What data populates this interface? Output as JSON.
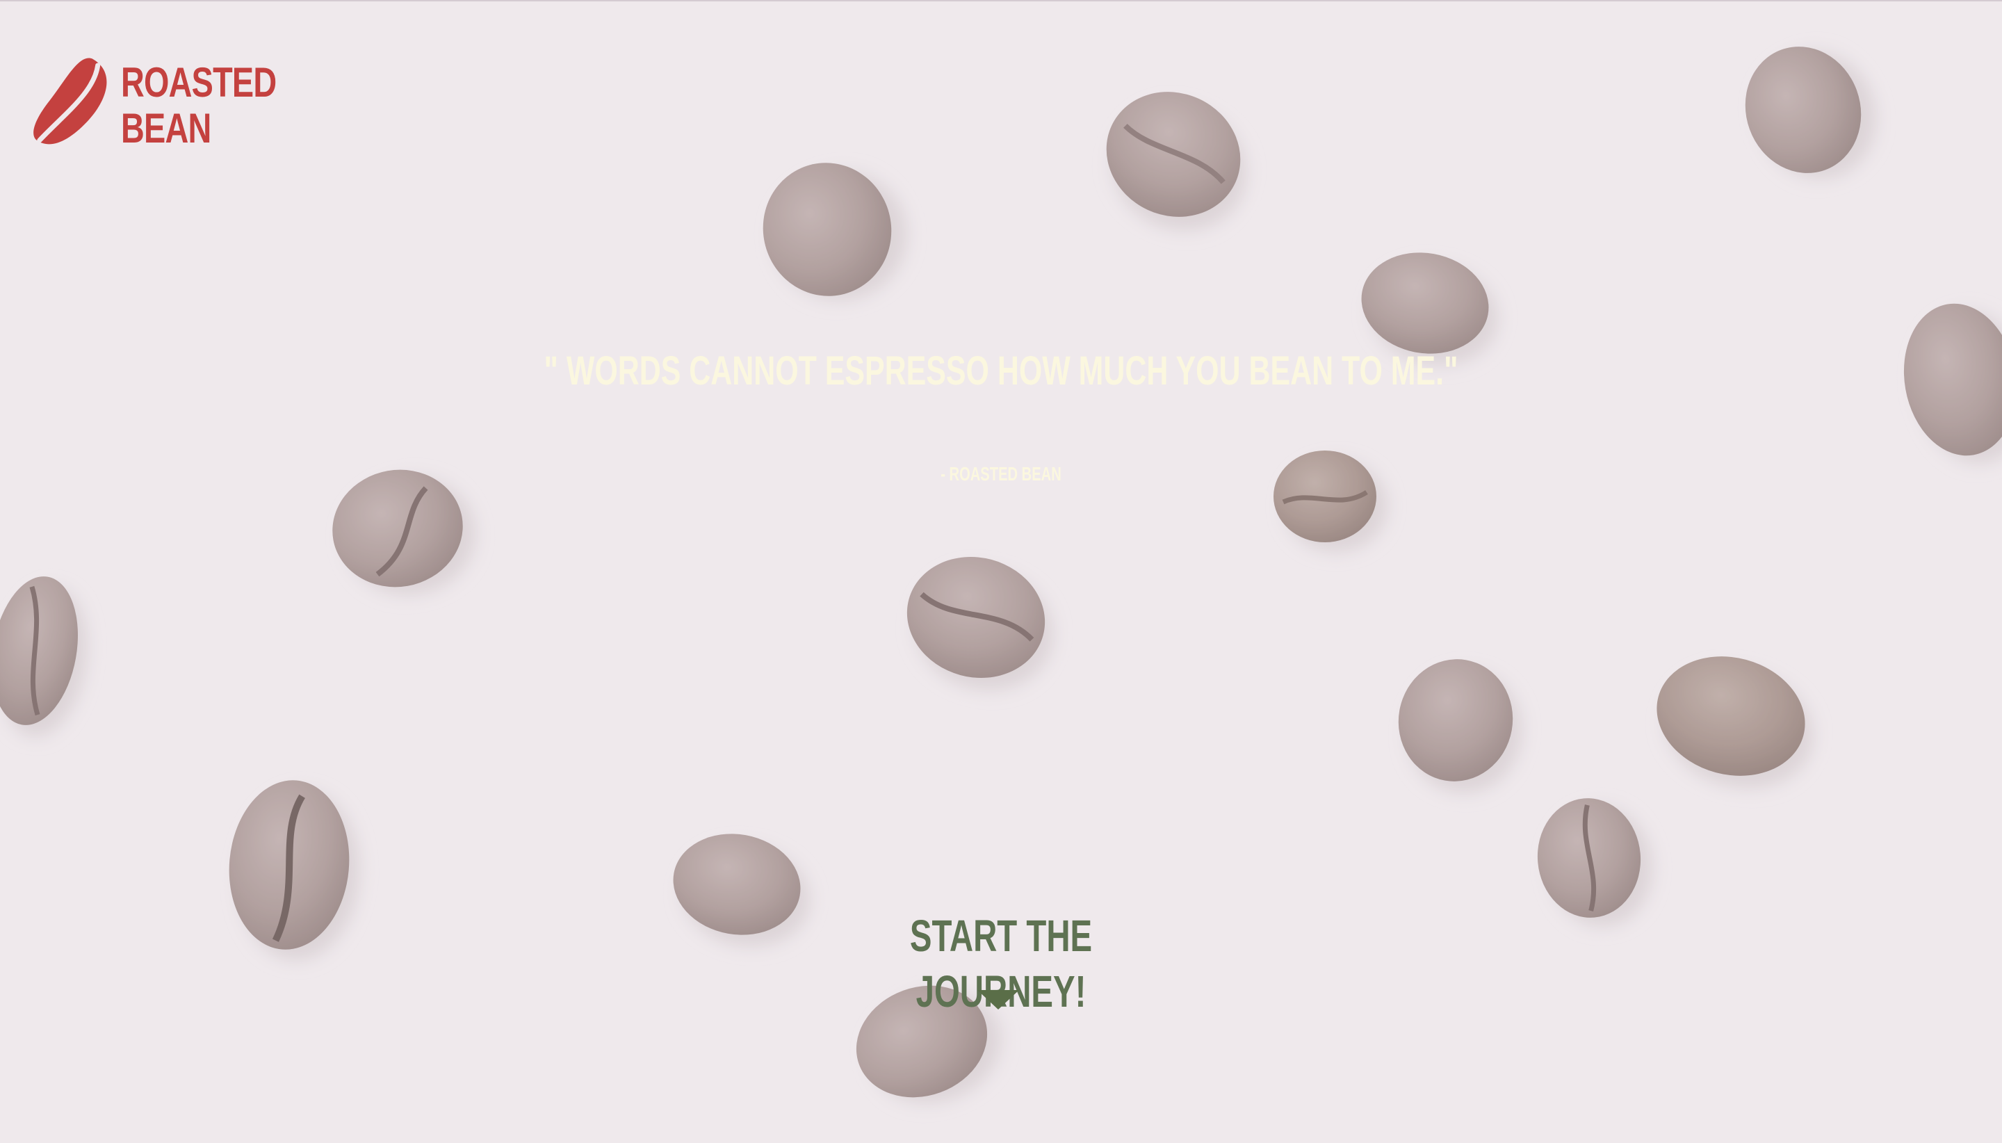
{
  "brand": {
    "name_line1": "ROASTED",
    "name_line2": "BEAN",
    "color": "#c4413f"
  },
  "hero": {
    "quote": "\" WORDS CANNOT ESPRESSO HOW MUCH YOU BEAN TO ME.\"",
    "attribution": "- ROASTED BEAN",
    "quote_color": "#fbf7df"
  },
  "cta": {
    "label": "START THE JOURNEY!",
    "arrow_icon": "triangle-down-icon",
    "color": "#5e7252"
  },
  "background": {
    "color": "#efe9ec",
    "decoration": "coffee-bean-icon"
  }
}
